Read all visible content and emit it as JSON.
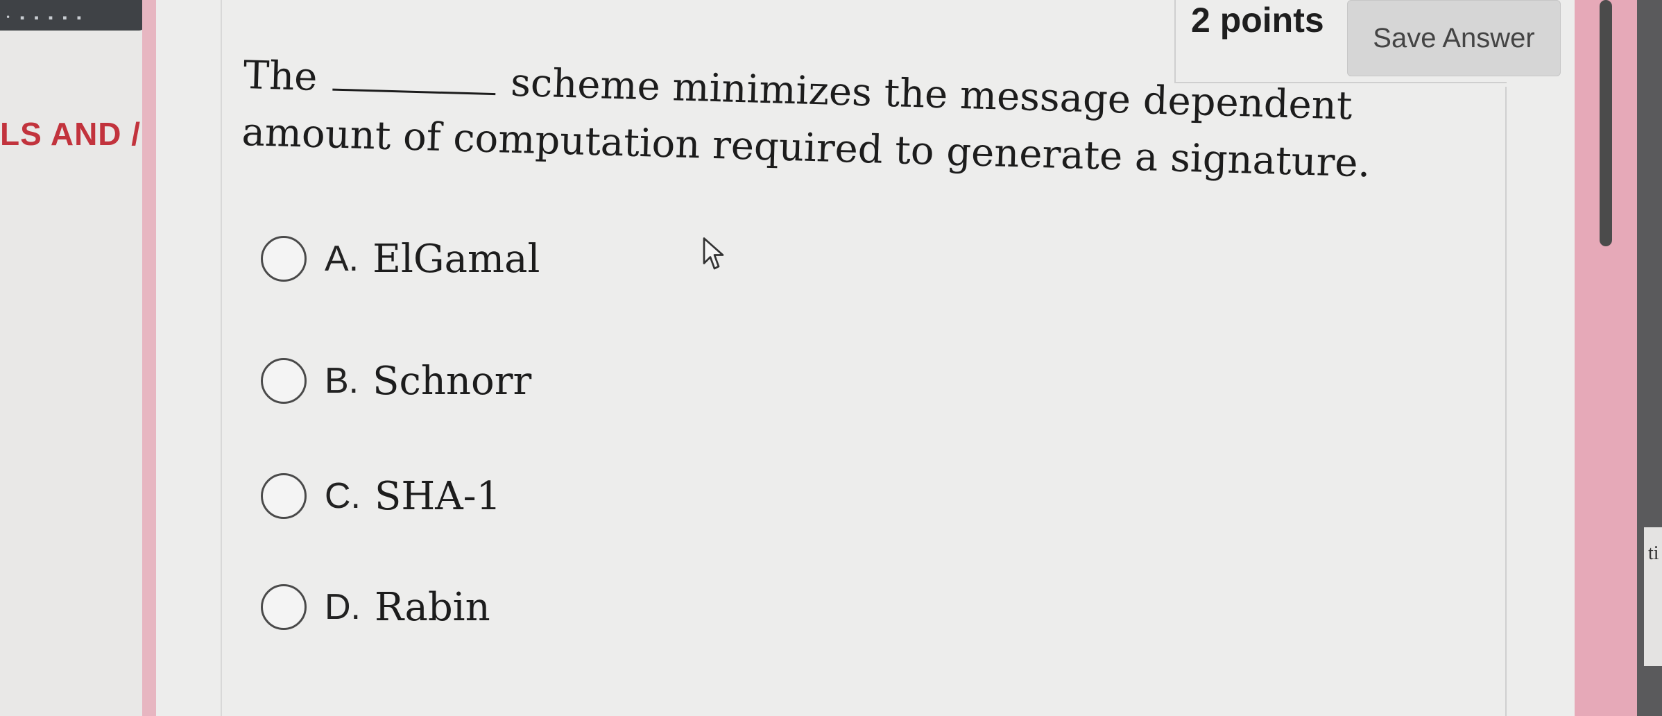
{
  "left": {
    "heading": "LS AND /"
  },
  "header": {
    "points": "2 points",
    "save_label": "Save Answer"
  },
  "question": {
    "before_blank": "The",
    "after_blank": "scheme minimizes the message dependent amount of computation required to generate a signature."
  },
  "options": [
    {
      "letter": "A.",
      "text": "ElGamal",
      "selected": false
    },
    {
      "letter": "B.",
      "text": "Schnorr",
      "selected": false
    },
    {
      "letter": "C.",
      "text": "SHA-1",
      "selected": false
    },
    {
      "letter": "D.",
      "text": "Rabin",
      "selected": false
    }
  ],
  "right_edge": {
    "fragment": "ti"
  }
}
